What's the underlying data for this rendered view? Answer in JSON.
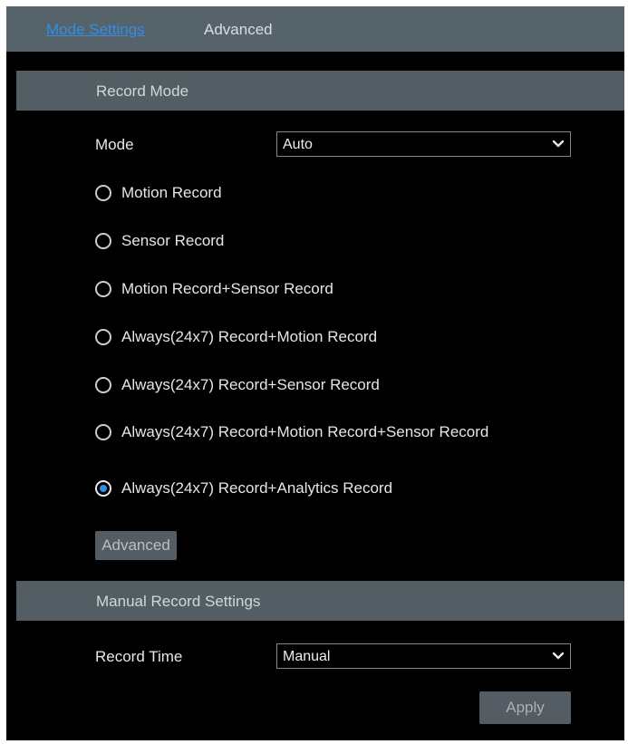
{
  "tabs": [
    {
      "label": "Mode Settings",
      "active": true
    },
    {
      "label": "Advanced",
      "active": false
    }
  ],
  "record_mode": {
    "header": "Record Mode",
    "mode_label": "Mode",
    "mode_value": "Auto",
    "options": [
      {
        "label": "Motion Record",
        "checked": false
      },
      {
        "label": "Sensor Record",
        "checked": false
      },
      {
        "label": "Motion Record+Sensor Record",
        "checked": false
      },
      {
        "label": "Always(24x7) Record+Motion Record",
        "checked": false
      },
      {
        "label": "Always(24x7) Record+Sensor Record",
        "checked": false
      },
      {
        "label": "Always(24x7) Record+Motion Record+Sensor Record",
        "checked": false
      },
      {
        "label": "Always(24x7) Record+Analytics Record",
        "checked": true
      }
    ],
    "advanced_button": "Advanced"
  },
  "manual_record": {
    "header": "Manual Record Settings",
    "record_time_label": "Record Time",
    "record_time_value": "Manual"
  },
  "apply_button": "Apply",
  "colors": {
    "accent": "#2f8fe6",
    "background": "#000000",
    "header_bar": "#525d64",
    "tab_bar": "#57636b",
    "button": "#545d63"
  },
  "icons": {
    "dropdown": "chevron-down-icon",
    "radio_selected": "radio-checked-icon",
    "radio_unselected": "radio-unchecked-icon"
  }
}
